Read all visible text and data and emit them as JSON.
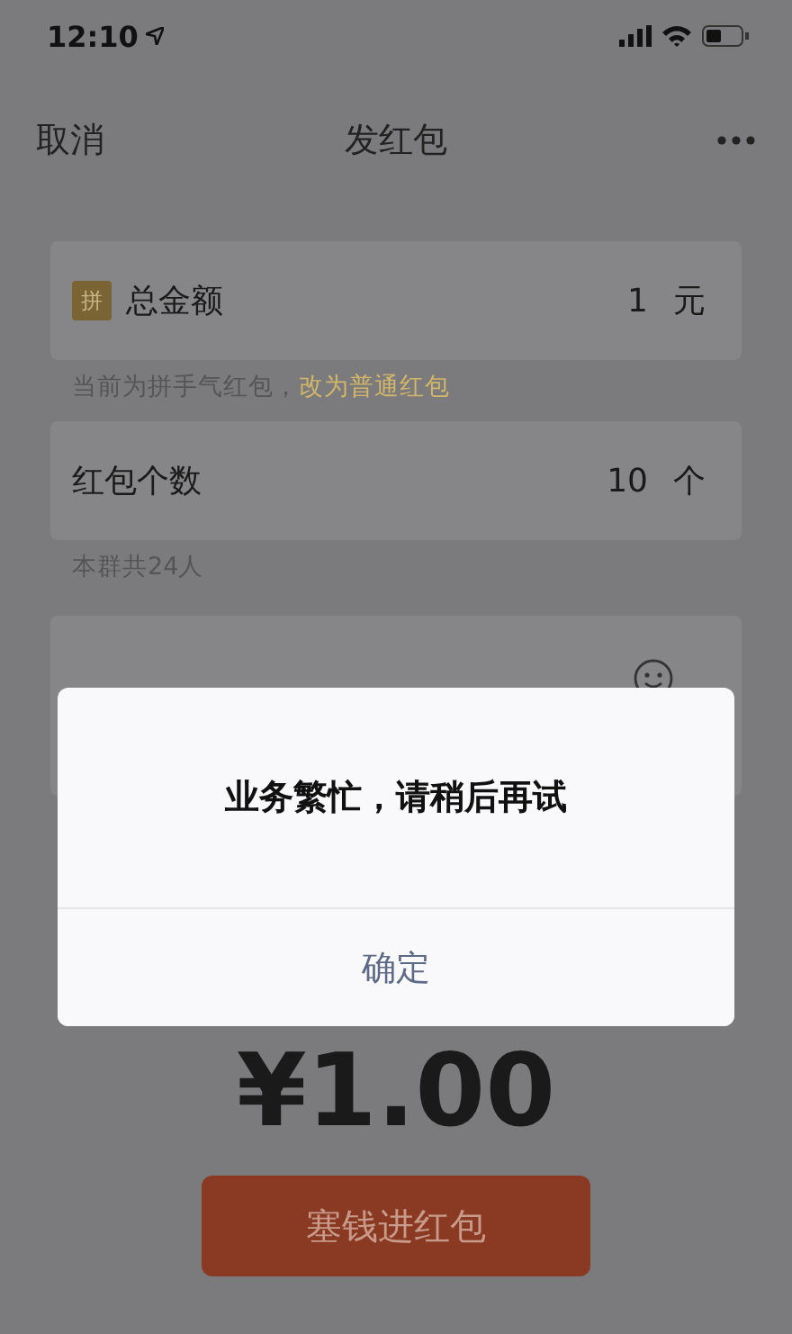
{
  "status_bar": {
    "time": "12:10"
  },
  "nav": {
    "cancel": "取消",
    "title": "发红包"
  },
  "fields": [
    {
      "kind": "amount",
      "badge": "拼",
      "label": "总金额",
      "value": "1",
      "unit": "元"
    },
    {
      "kind": "count",
      "label": "红包个数",
      "value": "10",
      "unit": "个"
    }
  ],
  "amount_hint": {
    "text": "当前为拼手气红包，",
    "link": "改为普通红包"
  },
  "count_hint": "本群共24人",
  "total": "¥1.00",
  "submit": "塞钱进红包",
  "dialog": {
    "message": "业务繁忙，请稍后再试",
    "button": "确定"
  }
}
